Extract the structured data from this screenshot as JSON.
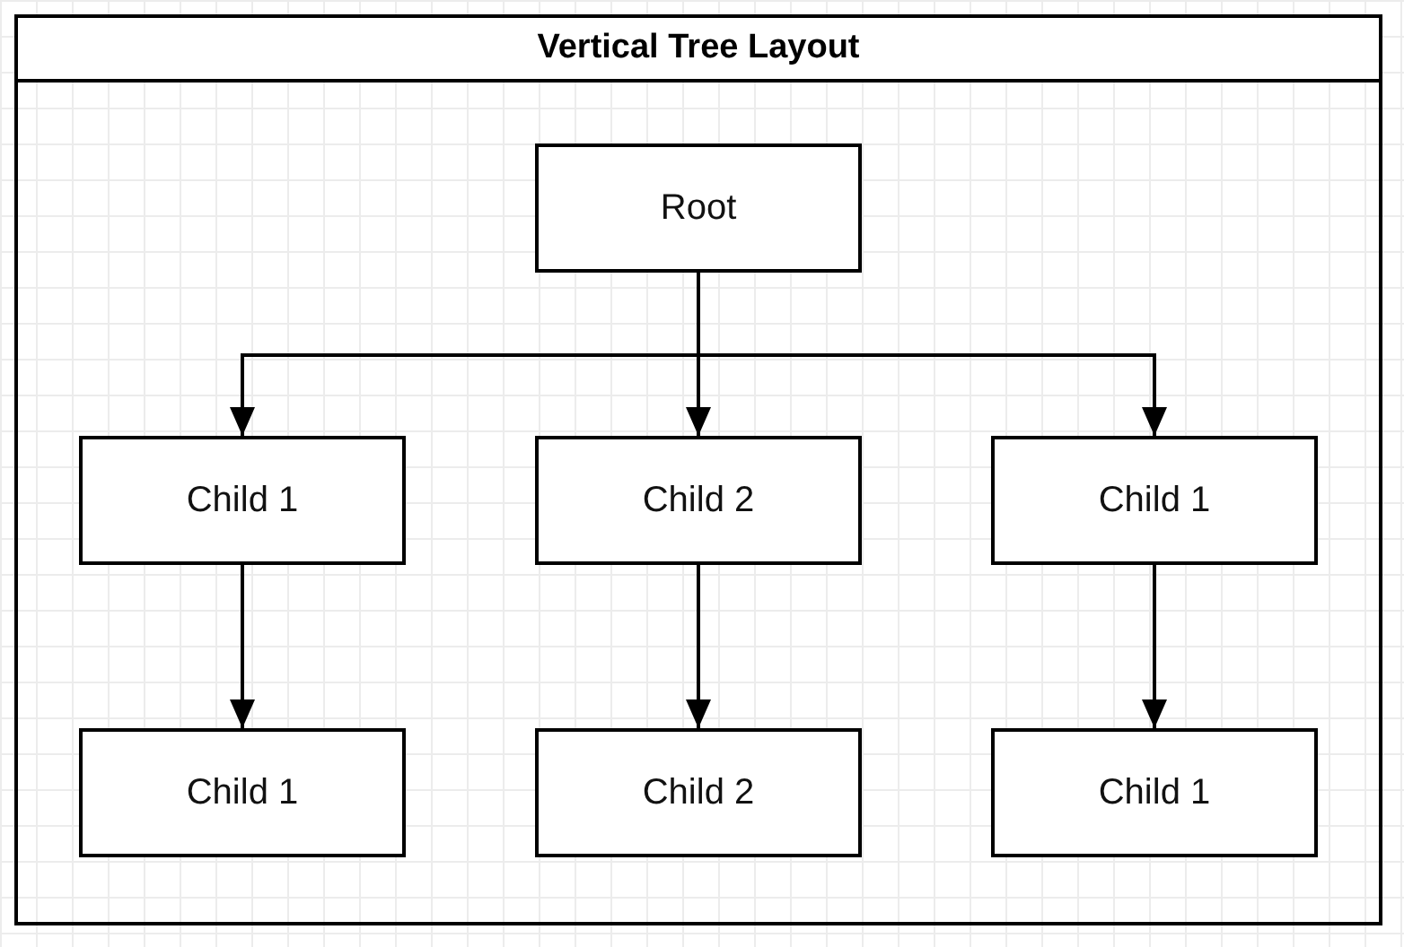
{
  "title": "Vertical Tree Layout",
  "root": {
    "label": "Root",
    "children": [
      {
        "label": "Child 1",
        "children": [
          {
            "label": "Child 1"
          }
        ]
      },
      {
        "label": "Child 2",
        "children": [
          {
            "label": "Child 2"
          }
        ]
      },
      {
        "label": "Child 1",
        "children": [
          {
            "label": "Child 1"
          }
        ]
      }
    ]
  }
}
